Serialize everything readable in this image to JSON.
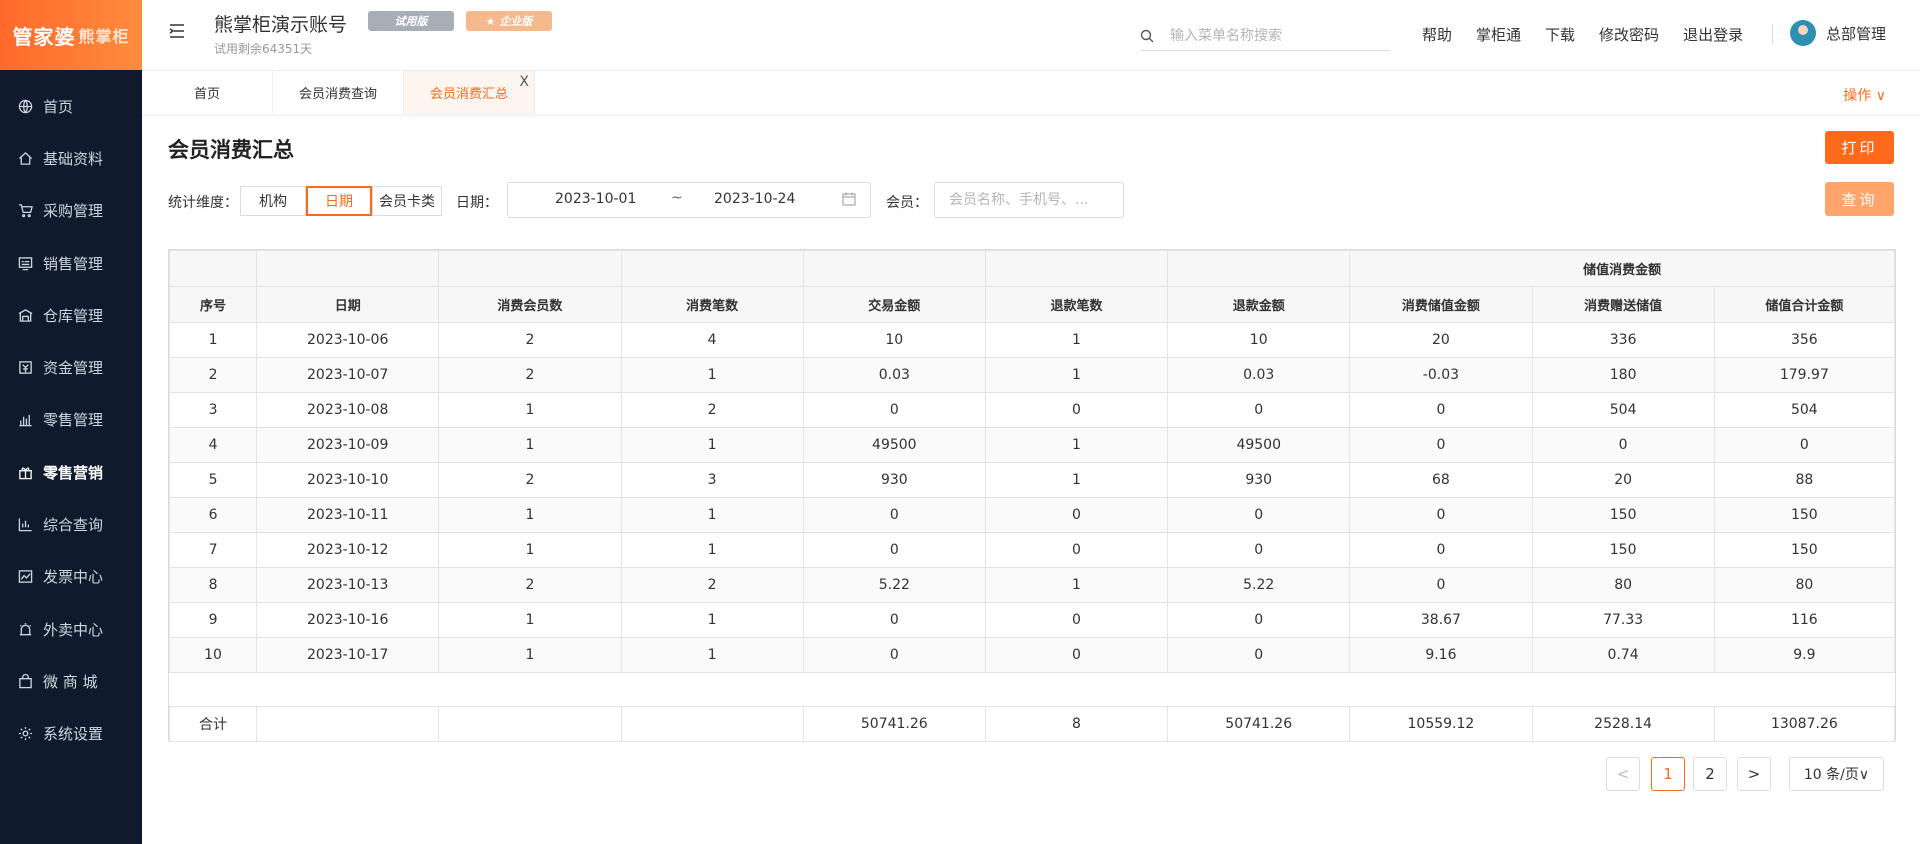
{
  "brand": {
    "name": "管家婆",
    "sub": "熊掌柜"
  },
  "sidebar": {
    "items": [
      {
        "label": "首页",
        "icon": "globe-icon",
        "active": false
      },
      {
        "label": "基础资料",
        "icon": "home-icon",
        "active": false
      },
      {
        "label": "采购管理",
        "icon": "cart-icon",
        "active": false
      },
      {
        "label": "销售管理",
        "icon": "monitor-icon",
        "active": false
      },
      {
        "label": "仓库管理",
        "icon": "warehouse-icon",
        "active": false
      },
      {
        "label": "资金管理",
        "icon": "wallet-icon",
        "active": false
      },
      {
        "label": "零售管理",
        "icon": "bar-chart-icon",
        "active": false
      },
      {
        "label": "零售营销",
        "icon": "gift-icon",
        "active": true
      },
      {
        "label": "综合查询",
        "icon": "stats-icon",
        "active": false
      },
      {
        "label": "发票中心",
        "icon": "trend-icon",
        "active": false
      },
      {
        "label": "外卖中心",
        "icon": "alarm-icon",
        "active": false
      },
      {
        "label": "微 商 城",
        "icon": "bag-icon",
        "active": false
      },
      {
        "label": "系统设置",
        "icon": "gear-icon",
        "active": false
      }
    ]
  },
  "header": {
    "account_name": "熊掌柜演示账号",
    "badge_trial": "试用版",
    "badge_enterprise": "企业版",
    "trial_left": "试用剩余64351天",
    "search_placeholder": "输入菜单名称搜索",
    "links": [
      "帮助",
      "掌柜通",
      "下载",
      "修改密码",
      "退出登录"
    ],
    "user_name": "总部管理"
  },
  "tabs": {
    "items": [
      {
        "label": "首页",
        "active": false
      },
      {
        "label": "会员消费查询",
        "active": false
      },
      {
        "label": "会员消费汇总",
        "active": true
      }
    ],
    "close_glyph": "X",
    "ops_label": "操作 ∨"
  },
  "page": {
    "title": "会员消费汇总",
    "print_label": "打印",
    "query_label": "查询",
    "dim_label": "统计维度：",
    "dim_options": [
      "机构",
      "日期",
      "会员卡类"
    ],
    "dim_selected": 1,
    "date_label": "日期：",
    "date_from": "2023-10-01",
    "date_sep": "~",
    "date_to": "2023-10-24",
    "member_label": "会员：",
    "member_placeholder": "会员名称、手机号、..."
  },
  "table": {
    "group_header": "储值消费金额",
    "columns": [
      "序号",
      "日期",
      "消费会员数",
      "消费笔数",
      "交易金额",
      "退款笔数",
      "退款金额",
      "消费储值金额",
      "消费赠送储值",
      "储值合计金额"
    ],
    "rows": [
      [
        "1",
        "2023-10-06",
        "2",
        "4",
        "10",
        "1",
        "10",
        "20",
        "336",
        "356"
      ],
      [
        "2",
        "2023-10-07",
        "2",
        "1",
        "0.03",
        "1",
        "0.03",
        "-0.03",
        "180",
        "179.97"
      ],
      [
        "3",
        "2023-10-08",
        "1",
        "2",
        "0",
        "0",
        "0",
        "0",
        "504",
        "504"
      ],
      [
        "4",
        "2023-10-09",
        "1",
        "1",
        "49500",
        "1",
        "49500",
        "0",
        "0",
        "0"
      ],
      [
        "5",
        "2023-10-10",
        "2",
        "3",
        "930",
        "1",
        "930",
        "68",
        "20",
        "88"
      ],
      [
        "6",
        "2023-10-11",
        "1",
        "1",
        "0",
        "0",
        "0",
        "0",
        "150",
        "150"
      ],
      [
        "7",
        "2023-10-12",
        "1",
        "1",
        "0",
        "0",
        "0",
        "0",
        "150",
        "150"
      ],
      [
        "8",
        "2023-10-13",
        "2",
        "2",
        "5.22",
        "1",
        "5.22",
        "0",
        "80",
        "80"
      ],
      [
        "9",
        "2023-10-16",
        "1",
        "1",
        "0",
        "0",
        "0",
        "38.67",
        "77.33",
        "116"
      ],
      [
        "10",
        "2023-10-17",
        "1",
        "1",
        "0",
        "0",
        "0",
        "9.16",
        "0.74",
        "9.9"
      ]
    ],
    "summary": [
      "合计",
      "",
      "",
      "",
      "50741.26",
      "8",
      "50741.26",
      "10559.12",
      "2528.14",
      "13087.26"
    ]
  },
  "pagination": {
    "prev": "<",
    "pages": [
      "1",
      "2"
    ],
    "current": "1",
    "next": ">",
    "page_size": "10 条/页∨"
  }
}
